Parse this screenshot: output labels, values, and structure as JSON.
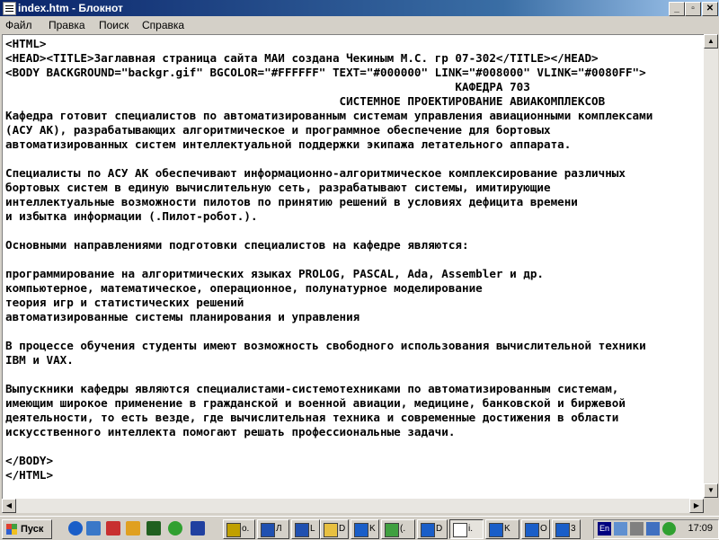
{
  "window": {
    "title": "index.htm - Блокнот",
    "controls": {
      "minimize": "_",
      "maximize": "▫",
      "close": "✕"
    }
  },
  "menu": [
    "Файл",
    "Правка",
    "Поиск",
    "Справка"
  ],
  "document": {
    "lines": [
      "<HTML>",
      "<HEAD><TITLE>Заглавная страница сайта МАИ создана Чекиным М.С. гр 07-302</TITLE></HEAD>",
      "<BODY BACKGROUND=\"backgr.gif\" BGCOLOR=\"#FFFFFF\" TEXT=\"#000000\" LINK=\"#008000\" VLINK=\"#0080FF\">",
      "                                                                  КАФЕДРА 703",
      "                                                 СИСТЕМНОЕ ПРОЕКТИРОВАНИЕ АВИАКОМПЛЕКСОВ",
      "Кафедра готовит специалистов по автоматизированным системам управления авиационными комплексами",
      "(АСУ АК), разрабатывающих алгоритмическое и программное обеспечение для бортовых",
      "автоматизированных систем интеллектуальной поддержки экипажа летательного аппарата.",
      "",
      "Специалисты по АСУ АК обеспечивают информационно-алгоритмическое комплексирование различных",
      "бортовых систем в единую вычислительную сеть, разрабатывают системы, имитирующие",
      "интеллектуальные возможности пилотов по принятию решений в условиях дефицита времени",
      "и избытка информации (.Пилот-робот.).",
      "",
      "Основными направлениями подготовки специалистов на кафедре являются:",
      "",
      "программирование на алгоритмических языках PROLOG, PASCAL, Ada, Assembler и др.",
      "компьютерное, математическое, операционное, полунатурное моделирование",
      "теория игр и статистических решений",
      "автоматизированные системы планирования и управления",
      "",
      "В процессе обучения студенты имеют возможность свободного использования вычислительной техники",
      "IBM и VAX.",
      "",
      "Выпускники кафедры являются специалистами-системотехниками по автоматизированным системам,",
      "имеющим широкое применение в гражданской и военной авиации, медицине, банковской и биржевой",
      "деятельности, то есть везде, где вычислительная техника и современные достижения в области",
      "искусственного интеллекта помогают решать профессиональные задачи.",
      "",
      "</BODY>",
      "</HTML>"
    ]
  },
  "taskbar": {
    "start_label": "Пуск",
    "tasks": [
      {
        "label": "о.",
        "icon": "winamp-icon"
      },
      {
        "label": "Л",
        "icon": "word-doc-icon"
      },
      {
        "label": "L",
        "icon": "word-doc-icon"
      },
      {
        "label": "D",
        "icon": "folder-icon"
      },
      {
        "label": "K",
        "icon": "ie-icon"
      },
      {
        "label": "(.",
        "icon": "app-icon"
      },
      {
        "label": "D",
        "icon": "ie-icon"
      },
      {
        "label": "i.",
        "icon": "notepad-icon",
        "active": true
      },
      {
        "label": "K",
        "icon": "ie-icon"
      },
      {
        "label": "О",
        "icon": "ie-icon"
      },
      {
        "label": "3",
        "icon": "ie-icon"
      }
    ],
    "tray": {
      "lang": "En",
      "clock": "17:09"
    }
  }
}
